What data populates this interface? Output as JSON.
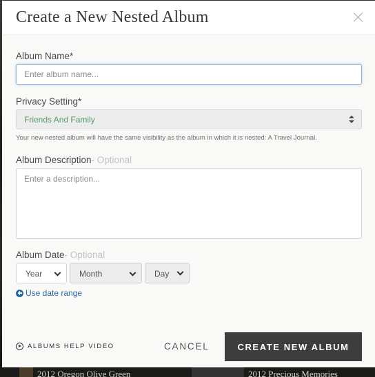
{
  "dialog": {
    "title": "Create a New Nested Album"
  },
  "form": {
    "album_name": {
      "label": "Album Name*",
      "placeholder": "Enter album name..."
    },
    "privacy": {
      "label": "Privacy Setting*",
      "selected": "Friends And Family",
      "helper": "Your new nested album will have the same visibility as the album in which it is nested: A Travel Journal."
    },
    "description": {
      "label": "Album Description",
      "optional": "- Optional",
      "placeholder": "Enter a description..."
    },
    "date": {
      "label": "Album Date",
      "optional": "- Optional",
      "year": "Year",
      "month": "Month",
      "day": "Day",
      "range_link": "Use date range"
    }
  },
  "footer": {
    "help_video": "ALBUMS HELP VIDEO",
    "cancel": "CANCEL",
    "create": "CREATE NEW ALBUM"
  },
  "background": {
    "caption_left": "2012 Oregon Olive Green",
    "caption_right": "2012 Precious Memories"
  },
  "colors": {
    "primary_button": "#3d3d3d",
    "link": "#2b6aa8",
    "privacy_value": "#5a9a6a",
    "focus_border": "#8db7d8"
  }
}
